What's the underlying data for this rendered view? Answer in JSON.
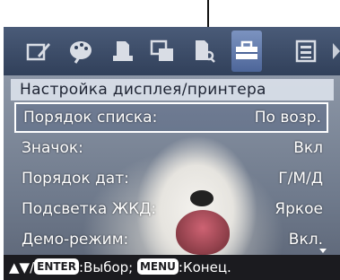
{
  "toolbar": {
    "icons": [
      "edit-frame-icon",
      "palette-icon",
      "print-page-icon",
      "layout-copy-icon",
      "document-search-icon",
      "toolbox-icon",
      "list-settings-icon"
    ],
    "selected_icon": "toolbox-icon"
  },
  "menu": {
    "title": "Настройка дисплея/принтера",
    "items": [
      {
        "label": "Порядок списка:",
        "value": "По возр."
      },
      {
        "label": "Значок:",
        "value": "Вкл"
      },
      {
        "label": "Порядок дат:",
        "value": "Г/М/Д"
      },
      {
        "label": "Подсветка ЖКД:",
        "value": "Яркое"
      },
      {
        "label": "Демо-режим:",
        "value": "Вкл."
      }
    ],
    "selected_index": 0
  },
  "footer": {
    "arrows": "▲▼/",
    "enter_key": "ENTER",
    "enter_action": ":Выбор; ",
    "menu_key": "MENU",
    "menu_action": ":Конец."
  }
}
